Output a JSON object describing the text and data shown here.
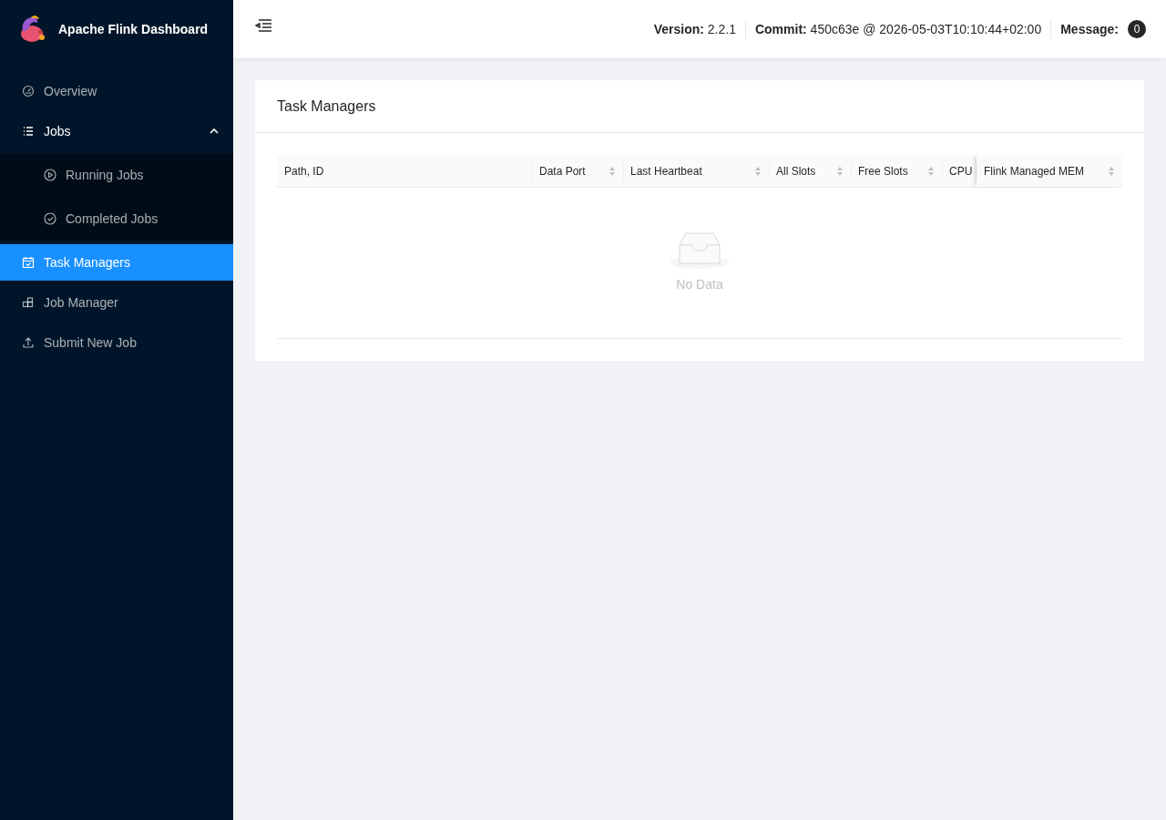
{
  "brand": {
    "title": "Apache Flink Dashboard"
  },
  "sidebar": {
    "items": [
      {
        "label": "Overview",
        "selected": false
      },
      {
        "label": "Jobs",
        "selected": false,
        "expanded": true,
        "children": [
          {
            "label": "Running Jobs",
            "selected": false
          },
          {
            "label": "Completed Jobs",
            "selected": false
          }
        ]
      },
      {
        "label": "Task Managers",
        "selected": true
      },
      {
        "label": "Job Manager",
        "selected": false
      },
      {
        "label": "Submit New Job",
        "selected": false
      }
    ]
  },
  "header": {
    "version": "**Version:** 2.2.1",
    "commit": "**Commit:** 450c63e @ 2026-05-03T10:10:44+02:00",
    "message_label": "Message:",
    "message_count": "0"
  },
  "card": {
    "title": "Task Managers",
    "table": {
      "columns": [
        {
          "label": "Path, ID",
          "sortable": false
        },
        {
          "label": "Data Port",
          "sortable": true
        },
        {
          "label": "Last Heartbeat",
          "sortable": true
        },
        {
          "label": "All Slots",
          "sortable": true
        },
        {
          "label": "Free Slots",
          "sortable": true
        },
        {
          "label": "CPU"
        },
        {
          "label": "Flink Managed MEM",
          "sortable": true
        }
      ],
      "empty_text": "No Data"
    }
  }
}
